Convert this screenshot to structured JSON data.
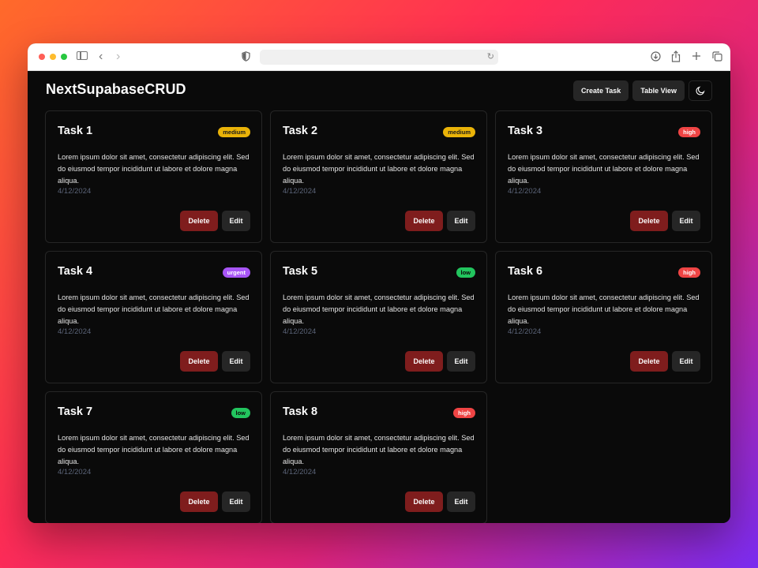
{
  "app": {
    "title": "NextSupabaseCRUD"
  },
  "header": {
    "create_label": "Create Task",
    "table_label": "Table View",
    "theme_icon": "moon-icon"
  },
  "tasks": [
    {
      "title": "Task 1",
      "priority": "medium",
      "description": "Lorem ipsum dolor sit amet, consectetur adipiscing elit. Sed do eiusmod tempor incididunt ut labore et dolore magna aliqua.",
      "date": "4/12/2024",
      "delete_label": "Delete",
      "edit_label": "Edit"
    },
    {
      "title": "Task 2",
      "priority": "medium",
      "description": "Lorem ipsum dolor sit amet, consectetur adipiscing elit. Sed do eiusmod tempor incididunt ut labore et dolore magna aliqua.",
      "date": "4/12/2024",
      "delete_label": "Delete",
      "edit_label": "Edit"
    },
    {
      "title": "Task 3",
      "priority": "high",
      "description": "Lorem ipsum dolor sit amet, consectetur adipiscing elit. Sed do eiusmod tempor incididunt ut labore et dolore magna aliqua.",
      "date": "4/12/2024",
      "delete_label": "Delete",
      "edit_label": "Edit"
    },
    {
      "title": "Task 4",
      "priority": "urgent",
      "description": "Lorem ipsum dolor sit amet, consectetur adipiscing elit. Sed do eiusmod tempor incididunt ut labore et dolore magna aliqua.",
      "date": "4/12/2024",
      "delete_label": "Delete",
      "edit_label": "Edit"
    },
    {
      "title": "Task 5",
      "priority": "low",
      "description": "Lorem ipsum dolor sit amet, consectetur adipiscing elit. Sed do eiusmod tempor incididunt ut labore et dolore magna aliqua.",
      "date": "4/12/2024",
      "delete_label": "Delete",
      "edit_label": "Edit"
    },
    {
      "title": "Task 6",
      "priority": "high",
      "description": "Lorem ipsum dolor sit amet, consectetur adipiscing elit. Sed do eiusmod tempor incididunt ut labore et dolore magna aliqua.",
      "date": "4/12/2024",
      "delete_label": "Delete",
      "edit_label": "Edit"
    },
    {
      "title": "Task 7",
      "priority": "low",
      "description": "Lorem ipsum dolor sit amet, consectetur adipiscing elit. Sed do eiusmod tempor incididunt ut labore et dolore magna aliqua.",
      "date": "4/12/2024",
      "delete_label": "Delete",
      "edit_label": "Edit"
    },
    {
      "title": "Task 8",
      "priority": "high",
      "description": "Lorem ipsum dolor sit amet, consectetur adipiscing elit. Sed do eiusmod tempor incididunt ut labore et dolore magna aliqua.",
      "date": "4/12/2024",
      "delete_label": "Delete",
      "edit_label": "Edit"
    }
  ],
  "colors": {
    "background": "#0a0a0a",
    "card_border": "#262626",
    "delete": "#7f1d1d",
    "medium": "#eab308",
    "high": "#ef4444",
    "low": "#22c55e",
    "urgent": "#a855f7",
    "date": "#5b6478"
  },
  "browser": {
    "icons": [
      "sidebar-icon",
      "back-icon",
      "forward-icon",
      "shield-icon",
      "reload-icon",
      "download-icon",
      "share-icon",
      "new-tab-icon",
      "tabs-icon"
    ]
  }
}
